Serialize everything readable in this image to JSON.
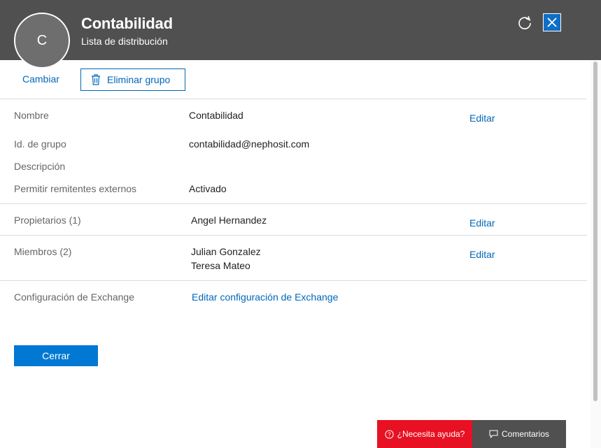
{
  "header": {
    "avatar_letter": "C",
    "title": "Contabilidad",
    "subtitle": "Lista de distribución",
    "refresh_icon": "refresh-icon",
    "close_icon": "close-icon",
    "background_color": "#505050",
    "close_color": "#0f6fc6"
  },
  "toolbar": {
    "change_label": "Cambiar",
    "delete_label": "Eliminar grupo",
    "delete_icon": "trash-icon"
  },
  "details": {
    "name_label": "Nombre",
    "name_value": "Contabilidad",
    "name_edit": "Editar",
    "group_id_label": "Id. de grupo",
    "group_id_value": "contabilidad@nephosit.com",
    "description_label": "Descripción",
    "external_label": "Permitir remitentes externos",
    "external_value": "Activado"
  },
  "owners": {
    "label": "Propietarios (1)",
    "members": [
      "Angel Hernandez"
    ],
    "edit": "Editar"
  },
  "members": {
    "label": "Miembros (2)",
    "members": [
      "Julian Gonzalez",
      "Teresa Mateo"
    ],
    "edit": "Editar"
  },
  "exchange": {
    "label": "Configuración de Exchange",
    "link": "Editar configuración de Exchange"
  },
  "footer": {
    "close_button": "Cerrar",
    "accent_color": "#0078d4"
  },
  "floating": {
    "help_label": "¿Necesita ayuda?",
    "help_icon": "question-circle-icon",
    "help_color": "#e81123",
    "feedback_label": "Comentarios",
    "feedback_icon": "speech-bubble-icon"
  }
}
